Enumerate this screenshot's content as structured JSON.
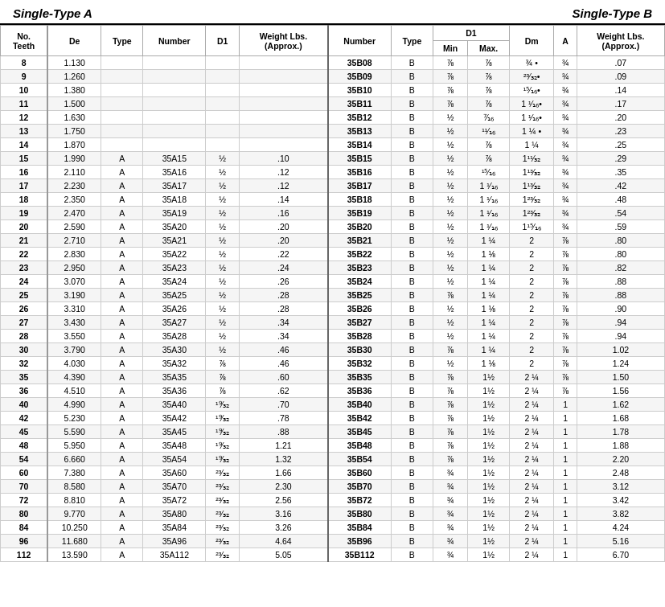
{
  "headers": {
    "left_section": "Single-Type A",
    "right_section": "Single-Type B"
  },
  "columns": {
    "left": [
      "No. Teeth",
      "De",
      "Type",
      "Number",
      "D1",
      "Weight Lbs. (Approx.)"
    ],
    "right": [
      "Number",
      "Type",
      "D1 Min",
      "D1 Max",
      "Dm",
      "A",
      "Weight Lbs. (Approx.)"
    ]
  },
  "rows": [
    {
      "teeth": 8,
      "de": "1.130",
      "type_a": "",
      "num_a": "",
      "d1_a": "",
      "wt_a": "",
      "num_b": "35B08",
      "type_b": "B",
      "d1min": "⅞",
      "d1max": "⅞",
      "dm": "¾ •",
      "a": "¾",
      "wt_b": ".07"
    },
    {
      "teeth": 9,
      "de": "1.260",
      "type_a": "",
      "num_a": "",
      "d1_a": "",
      "wt_a": "",
      "num_b": "35B09",
      "type_b": "B",
      "d1min": "⅞",
      "d1max": "⅞",
      "dm": "²³⁄₃₂•",
      "a": "¾",
      "wt_b": ".09"
    },
    {
      "teeth": 10,
      "de": "1.380",
      "type_a": "",
      "num_a": "",
      "d1_a": "",
      "wt_a": "",
      "num_b": "35B10",
      "type_b": "B",
      "d1min": "⅞",
      "d1max": "⅞",
      "dm": "¹⁵⁄₁₆•",
      "a": "¾",
      "wt_b": ".14"
    },
    {
      "teeth": 11,
      "de": "1.500",
      "type_a": "",
      "num_a": "",
      "d1_a": "",
      "wt_a": "",
      "num_b": "35B11",
      "type_b": "B",
      "d1min": "⅞",
      "d1max": "⅞",
      "dm": "1 ¹⁄₁₆•",
      "a": "¾",
      "wt_b": ".17"
    },
    {
      "teeth": 12,
      "de": "1.630",
      "type_a": "",
      "num_a": "",
      "d1_a": "",
      "wt_a": "",
      "num_b": "35B12",
      "type_b": "B",
      "d1min": "½",
      "d1max": "⁷⁄₁₆",
      "dm": "1 ¹⁄₁₆•",
      "a": "¾",
      "wt_b": ".20"
    },
    {
      "teeth": 13,
      "de": "1.750",
      "type_a": "",
      "num_a": "",
      "d1_a": "",
      "wt_a": "",
      "num_b": "35B13",
      "type_b": "B",
      "d1min": "½",
      "d1max": "¹¹⁄₁₆",
      "dm": "1 ¼ •",
      "a": "¾",
      "wt_b": ".23"
    },
    {
      "teeth": 14,
      "de": "1.870",
      "type_a": "",
      "num_a": "",
      "d1_a": "",
      "wt_a": "",
      "num_b": "35B14",
      "type_b": "B",
      "d1min": "½",
      "d1max": "⅞",
      "dm": "1 ¼",
      "a": "¾",
      "wt_b": ".25"
    },
    {
      "teeth": 15,
      "de": "1.990",
      "type_a": "A",
      "num_a": "35A15",
      "d1_a": "½",
      "wt_a": ".10",
      "num_b": "35B15",
      "type_b": "B",
      "d1min": "½",
      "d1max": "⅞",
      "dm": "1¹¹⁄₃₂",
      "a": "¾",
      "wt_b": ".29"
    },
    {
      "teeth": 16,
      "de": "2.110",
      "type_a": "A",
      "num_a": "35A16",
      "d1_a": "½",
      "wt_a": ".12",
      "num_b": "35B16",
      "type_b": "B",
      "d1min": "½",
      "d1max": "¹⁵⁄₁₆",
      "dm": "1¹³⁄₃₂",
      "a": "¾",
      "wt_b": ".35"
    },
    {
      "teeth": 17,
      "de": "2.230",
      "type_a": "A",
      "num_a": "35A17",
      "d1_a": "½",
      "wt_a": ".12",
      "num_b": "35B17",
      "type_b": "B",
      "d1min": "½",
      "d1max": "1 ¹⁄₁₆",
      "dm": "1¹³⁄₃₂",
      "a": "¾",
      "wt_b": ".42"
    },
    {
      "teeth": 18,
      "de": "2.350",
      "type_a": "A",
      "num_a": "35A18",
      "d1_a": "½",
      "wt_a": ".14",
      "num_b": "35B18",
      "type_b": "B",
      "d1min": "½",
      "d1max": "1 ¹⁄₁₆",
      "dm": "1²³⁄₃₂",
      "a": "¾",
      "wt_b": ".48"
    },
    {
      "teeth": 19,
      "de": "2.470",
      "type_a": "A",
      "num_a": "35A19",
      "d1_a": "½",
      "wt_a": ".16",
      "num_b": "35B19",
      "type_b": "B",
      "d1min": "½",
      "d1max": "1 ¹⁄₁₆",
      "dm": "1²³⁄₃₂",
      "a": "¾",
      "wt_b": ".54"
    },
    {
      "teeth": 20,
      "de": "2.590",
      "type_a": "A",
      "num_a": "35A20",
      "d1_a": "½",
      "wt_a": ".20",
      "num_b": "35B20",
      "type_b": "B",
      "d1min": "½",
      "d1max": "1 ¹⁄₁₆",
      "dm": "1¹⁵⁄₁₆",
      "a": "¾",
      "wt_b": ".59"
    },
    {
      "teeth": 21,
      "de": "2.710",
      "type_a": "A",
      "num_a": "35A21",
      "d1_a": "½",
      "wt_a": ".20",
      "num_b": "35B21",
      "type_b": "B",
      "d1min": "½",
      "d1max": "1 ¼",
      "dm": "2",
      "a": "⅞",
      "wt_b": ".80"
    },
    {
      "teeth": 22,
      "de": "2.830",
      "type_a": "A",
      "num_a": "35A22",
      "d1_a": "½",
      "wt_a": ".22",
      "num_b": "35B22",
      "type_b": "B",
      "d1min": "½",
      "d1max": "1 ⅛",
      "dm": "2",
      "a": "⅞",
      "wt_b": ".80"
    },
    {
      "teeth": 23,
      "de": "2.950",
      "type_a": "A",
      "num_a": "35A23",
      "d1_a": "½",
      "wt_a": ".24",
      "num_b": "35B23",
      "type_b": "B",
      "d1min": "½",
      "d1max": "1 ¼",
      "dm": "2",
      "a": "⅞",
      "wt_b": ".82"
    },
    {
      "teeth": 24,
      "de": "3.070",
      "type_a": "A",
      "num_a": "35A24",
      "d1_a": "½",
      "wt_a": ".26",
      "num_b": "35B24",
      "type_b": "B",
      "d1min": "½",
      "d1max": "1 ¼",
      "dm": "2",
      "a": "⅞",
      "wt_b": ".88"
    },
    {
      "teeth": 25,
      "de": "3.190",
      "type_a": "A",
      "num_a": "35A25",
      "d1_a": "½",
      "wt_a": ".28",
      "num_b": "35B25",
      "type_b": "B",
      "d1min": "⅞",
      "d1max": "1 ¼",
      "dm": "2",
      "a": "⅞",
      "wt_b": ".88"
    },
    {
      "teeth": 26,
      "de": "3.310",
      "type_a": "A",
      "num_a": "35A26",
      "d1_a": "½",
      "wt_a": ".28",
      "num_b": "35B26",
      "type_b": "B",
      "d1min": "½",
      "d1max": "1 ⅛",
      "dm": "2",
      "a": "⅞",
      "wt_b": ".90"
    },
    {
      "teeth": 27,
      "de": "3.430",
      "type_a": "A",
      "num_a": "35A27",
      "d1_a": "½",
      "wt_a": ".34",
      "num_b": "35B27",
      "type_b": "B",
      "d1min": "½",
      "d1max": "1 ¼",
      "dm": "2",
      "a": "⅞",
      "wt_b": ".94"
    },
    {
      "teeth": 28,
      "de": "3.550",
      "type_a": "A",
      "num_a": "35A28",
      "d1_a": "½",
      "wt_a": ".34",
      "num_b": "35B28",
      "type_b": "B",
      "d1min": "½",
      "d1max": "1 ¼",
      "dm": "2",
      "a": "⅞",
      "wt_b": ".94"
    },
    {
      "teeth": 30,
      "de": "3.790",
      "type_a": "A",
      "num_a": "35A30",
      "d1_a": "½",
      "wt_a": ".46",
      "num_b": "35B30",
      "type_b": "B",
      "d1min": "⅞",
      "d1max": "1 ¼",
      "dm": "2",
      "a": "⅞",
      "wt_b": "1.02"
    },
    {
      "teeth": 32,
      "de": "4.030",
      "type_a": "A",
      "num_a": "35A32",
      "d1_a": "⅞",
      "wt_a": ".46",
      "num_b": "35B32",
      "type_b": "B",
      "d1min": "½",
      "d1max": "1 ⅛",
      "dm": "2",
      "a": "⅞",
      "wt_b": "1.24"
    },
    {
      "teeth": 35,
      "de": "4.390",
      "type_a": "A",
      "num_a": "35A35",
      "d1_a": "⅞",
      "wt_a": ".60",
      "num_b": "35B35",
      "type_b": "B",
      "d1min": "⅞",
      "d1max": "1½",
      "dm": "2 ¼",
      "a": "⅞",
      "wt_b": "1.50"
    },
    {
      "teeth": 36,
      "de": "4.510",
      "type_a": "A",
      "num_a": "35A36",
      "d1_a": "⅞",
      "wt_a": ".62",
      "num_b": "35B36",
      "type_b": "B",
      "d1min": "⅞",
      "d1max": "1½",
      "dm": "2 ¼",
      "a": "⅞",
      "wt_b": "1.56"
    },
    {
      "teeth": 40,
      "de": "4.990",
      "type_a": "A",
      "num_a": "35A40",
      "d1_a": "¹⁹⁄₃₂",
      "wt_a": ".70",
      "num_b": "35B40",
      "type_b": "B",
      "d1min": "⅞",
      "d1max": "1½",
      "dm": "2 ¼",
      "a": "1",
      "wt_b": "1.62"
    },
    {
      "teeth": 42,
      "de": "5.230",
      "type_a": "A",
      "num_a": "35A42",
      "d1_a": "¹⁹⁄₃₂",
      "wt_a": ".78",
      "num_b": "35B42",
      "type_b": "B",
      "d1min": "⅞",
      "d1max": "1½",
      "dm": "2 ¼",
      "a": "1",
      "wt_b": "1.68"
    },
    {
      "teeth": 45,
      "de": "5.590",
      "type_a": "A",
      "num_a": "35A45",
      "d1_a": "¹⁹⁄₃₂",
      "wt_a": ".88",
      "num_b": "35B45",
      "type_b": "B",
      "d1min": "⅞",
      "d1max": "1½",
      "dm": "2 ¼",
      "a": "1",
      "wt_b": "1.78"
    },
    {
      "teeth": 48,
      "de": "5.950",
      "type_a": "A",
      "num_a": "35A48",
      "d1_a": "¹⁹⁄₃₂",
      "wt_a": "1.21",
      "num_b": "35B48",
      "type_b": "B",
      "d1min": "⅞",
      "d1max": "1½",
      "dm": "2 ¼",
      "a": "1",
      "wt_b": "1.88"
    },
    {
      "teeth": 54,
      "de": "6.660",
      "type_a": "A",
      "num_a": "35A54",
      "d1_a": "¹⁹⁄₃₂",
      "wt_a": "1.32",
      "num_b": "35B54",
      "type_b": "B",
      "d1min": "⅞",
      "d1max": "1½",
      "dm": "2 ¼",
      "a": "1",
      "wt_b": "2.20"
    },
    {
      "teeth": 60,
      "de": "7.380",
      "type_a": "A",
      "num_a": "35A60",
      "d1_a": "²³⁄₃₂",
      "wt_a": "1.66",
      "num_b": "35B60",
      "type_b": "B",
      "d1min": "¾",
      "d1max": "1½",
      "dm": "2 ¼",
      "a": "1",
      "wt_b": "2.48"
    },
    {
      "teeth": 70,
      "de": "8.580",
      "type_a": "A",
      "num_a": "35A70",
      "d1_a": "²³⁄₃₂",
      "wt_a": "2.30",
      "num_b": "35B70",
      "type_b": "B",
      "d1min": "¾",
      "d1max": "1½",
      "dm": "2 ¼",
      "a": "1",
      "wt_b": "3.12"
    },
    {
      "teeth": 72,
      "de": "8.810",
      "type_a": "A",
      "num_a": "35A72",
      "d1_a": "²³⁄₃₂",
      "wt_a": "2.56",
      "num_b": "35B72",
      "type_b": "B",
      "d1min": "¾",
      "d1max": "1½",
      "dm": "2 ¼",
      "a": "1",
      "wt_b": "3.42"
    },
    {
      "teeth": 80,
      "de": "9.770",
      "type_a": "A",
      "num_a": "35A80",
      "d1_a": "²³⁄₃₂",
      "wt_a": "3.16",
      "num_b": "35B80",
      "type_b": "B",
      "d1min": "¾",
      "d1max": "1½",
      "dm": "2 ¼",
      "a": "1",
      "wt_b": "3.82"
    },
    {
      "teeth": 84,
      "de": "10.250",
      "type_a": "A",
      "num_a": "35A84",
      "d1_a": "²³⁄₃₂",
      "wt_a": "3.26",
      "num_b": "35B84",
      "type_b": "B",
      "d1min": "¾",
      "d1max": "1½",
      "dm": "2 ¼",
      "a": "1",
      "wt_b": "4.24"
    },
    {
      "teeth": 96,
      "de": "11.680",
      "type_a": "A",
      "num_a": "35A96",
      "d1_a": "²³⁄₃₂",
      "wt_a": "4.64",
      "num_b": "35B96",
      "type_b": "B",
      "d1min": "¾",
      "d1max": "1½",
      "dm": "2 ¼",
      "a": "1",
      "wt_b": "5.16"
    },
    {
      "teeth": 112,
      "de": "13.590",
      "type_a": "A",
      "num_a": "35A112",
      "d1_a": "²³⁄₃₂",
      "wt_a": "5.05",
      "num_b": "35B112",
      "type_b": "B",
      "d1min": "¾",
      "d1max": "1½",
      "dm": "2 ¼",
      "a": "1",
      "wt_b": "6.70"
    }
  ]
}
